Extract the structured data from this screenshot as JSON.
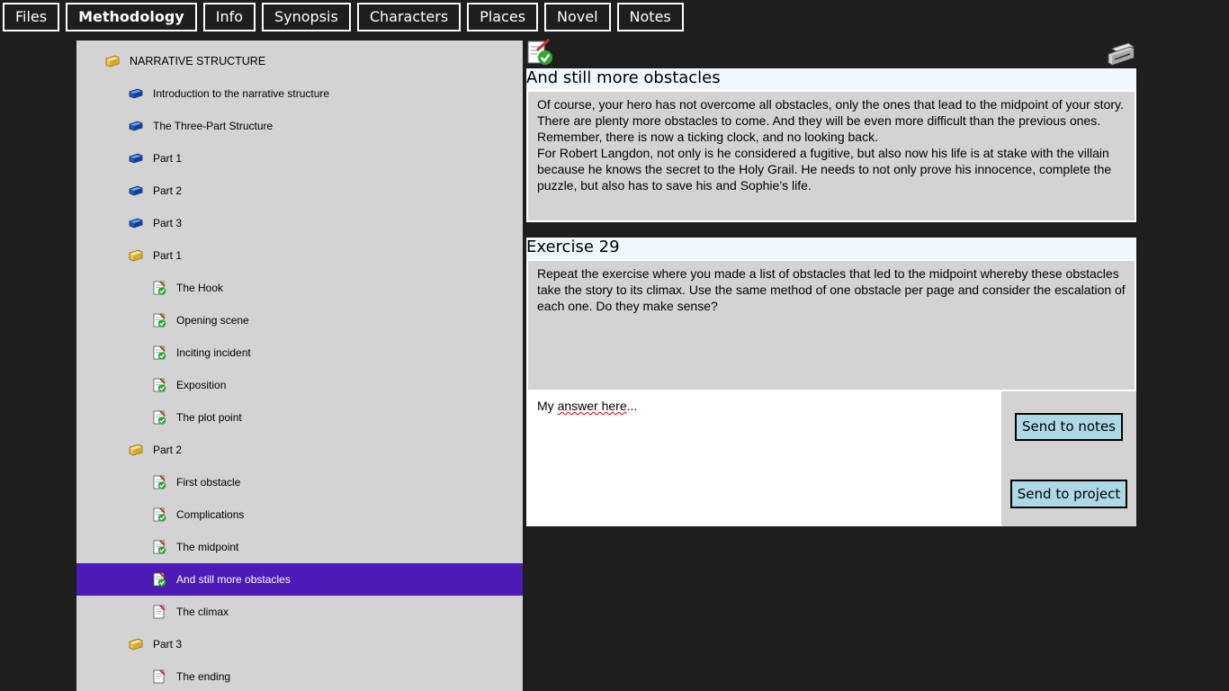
{
  "tabs": [
    {
      "label": "Files",
      "active": false
    },
    {
      "label": "Methodology",
      "active": true
    },
    {
      "label": "Info",
      "active": false
    },
    {
      "label": "Synopsis",
      "active": false
    },
    {
      "label": "Characters",
      "active": false
    },
    {
      "label": "Places",
      "active": false
    },
    {
      "label": "Novel",
      "active": false
    },
    {
      "label": "Notes",
      "active": false
    }
  ],
  "tree": [
    {
      "label": "NARRATIVE STRUCTURE",
      "icon": "folder-icon",
      "level": 0
    },
    {
      "label": "Introduction to the narrative structure",
      "icon": "book-icon",
      "level": 1
    },
    {
      "label": "The Three-Part Structure",
      "icon": "book-icon",
      "level": 1
    },
    {
      "label": "Part 1",
      "icon": "book-icon",
      "level": 1
    },
    {
      "label": "Part 2",
      "icon": "book-icon",
      "level": 1
    },
    {
      "label": "Part 3",
      "icon": "book-icon",
      "level": 1
    },
    {
      "label": "Part 1",
      "icon": "folder-icon",
      "level": 1
    },
    {
      "label": "The Hook",
      "icon": "checked-document-icon",
      "level": 2
    },
    {
      "label": "Opening scene",
      "icon": "checked-document-icon",
      "level": 2
    },
    {
      "label": "Inciting incident",
      "icon": "checked-document-icon",
      "level": 2
    },
    {
      "label": "Exposition",
      "icon": "checked-document-icon",
      "level": 2
    },
    {
      "label": "The plot point",
      "icon": "checked-document-icon",
      "level": 2
    },
    {
      "label": "Part 2",
      "icon": "folder-icon",
      "level": 1
    },
    {
      "label": "First obstacle",
      "icon": "checked-document-icon",
      "level": 2
    },
    {
      "label": "Complications",
      "icon": "checked-document-icon",
      "level": 2
    },
    {
      "label": "The midpoint",
      "icon": "checked-document-icon",
      "level": 2
    },
    {
      "label": "And still more obstacles",
      "icon": "checked-document-icon",
      "level": 2,
      "selected": true
    },
    {
      "label": "The climax",
      "icon": "document-icon",
      "level": 2
    },
    {
      "label": "Part 3",
      "icon": "folder-icon",
      "level": 1
    },
    {
      "label": "The ending",
      "icon": "document-icon",
      "level": 2
    }
  ],
  "lesson": {
    "title": "And still more obstacles",
    "paragraphs": [
      "Of course, your hero has not overcome all obstacles, only the ones that lead to the midpoint of your story. There are plenty more obstacles to come. And they will be even more difficult than the previous ones. Remember, there is now a ticking clock, and no looking back.",
      "For Robert Langdon, not only is he considered a fugitive, but also now his life is at stake with the villain because he knows the secret to the Holy Grail. He needs to not only prove his innocence, complete the puzzle, but also has to save his and Sophie’s life."
    ]
  },
  "exercise": {
    "title": "Exercise 29",
    "text": "Repeat the exercise where you made a list of obstacles that led to the midpoint whereby these obstacles take the story to its climax. Use the same method of one obstacle per page and consider the escalation of each one. Do they make sense?"
  },
  "answer": {
    "word1": "My",
    "word2": "answer here",
    "tail": "..."
  },
  "buttons": {
    "send_notes": "Send to notes",
    "send_project": "Send to project"
  },
  "colors": {
    "selected": "#4c1ab5",
    "panel": "#d3d3d3",
    "button": "#add8e6",
    "title_bg": "#f0f8ff"
  }
}
